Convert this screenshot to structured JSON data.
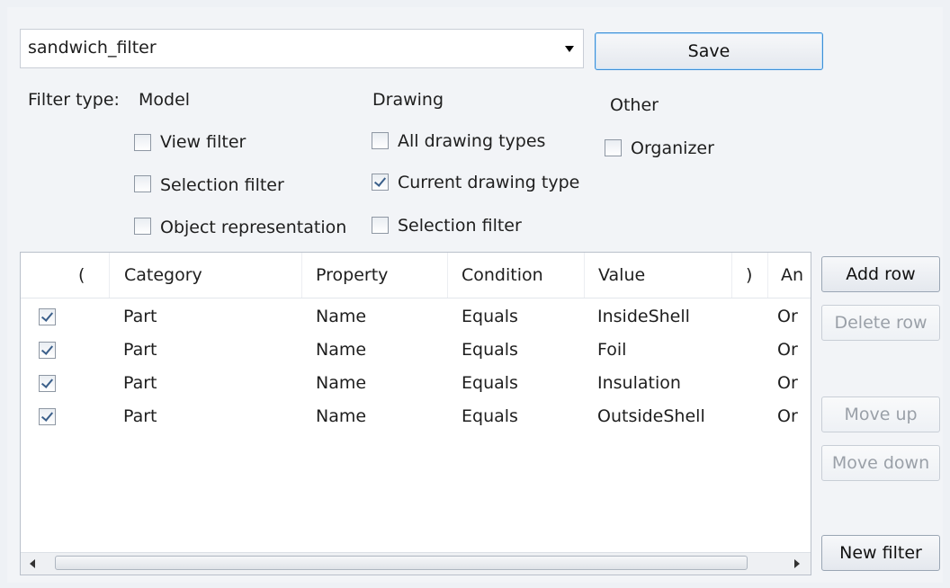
{
  "filter": {
    "name": "sandwich_filter",
    "save_label": "Save"
  },
  "filter_type": {
    "label": "Filter type:",
    "model": {
      "heading": "Model",
      "options": [
        {
          "label": "View filter",
          "checked": false
        },
        {
          "label": "Selection filter",
          "checked": false
        },
        {
          "label": "Object representation",
          "checked": false
        }
      ]
    },
    "drawing": {
      "heading": "Drawing",
      "options": [
        {
          "label": "All drawing types",
          "checked": false
        },
        {
          "label": "Current drawing type",
          "checked": true
        },
        {
          "label": "Selection filter",
          "checked": false
        }
      ]
    },
    "other": {
      "heading": "Other",
      "options": [
        {
          "label": "Organizer",
          "checked": false
        }
      ]
    }
  },
  "grid": {
    "columns": [
      "(",
      "Category",
      "Property",
      "Condition",
      "Value",
      ")",
      "And/Or"
    ],
    "column_labels_visible": [
      "(",
      "Category",
      "Property",
      "Condition",
      "Value",
      ")",
      "An"
    ],
    "rows": [
      {
        "enabled": true,
        "category": "Part",
        "property": "Name",
        "condition": "Equals",
        "value": "InsideShell",
        "andor": "Or"
      },
      {
        "enabled": true,
        "category": "Part",
        "property": "Name",
        "condition": "Equals",
        "value": "Foil",
        "andor": "Or"
      },
      {
        "enabled": true,
        "category": "Part",
        "property": "Name",
        "condition": "Equals",
        "value": "Insulation",
        "andor": "Or"
      },
      {
        "enabled": true,
        "category": "Part",
        "property": "Name",
        "condition": "Equals",
        "value": "OutsideShell",
        "andor": "Or"
      }
    ]
  },
  "actions": {
    "add_row": "Add row",
    "delete_row": "Delete row",
    "move_up": "Move up",
    "move_down": "Move down",
    "new_filter": "New filter"
  }
}
